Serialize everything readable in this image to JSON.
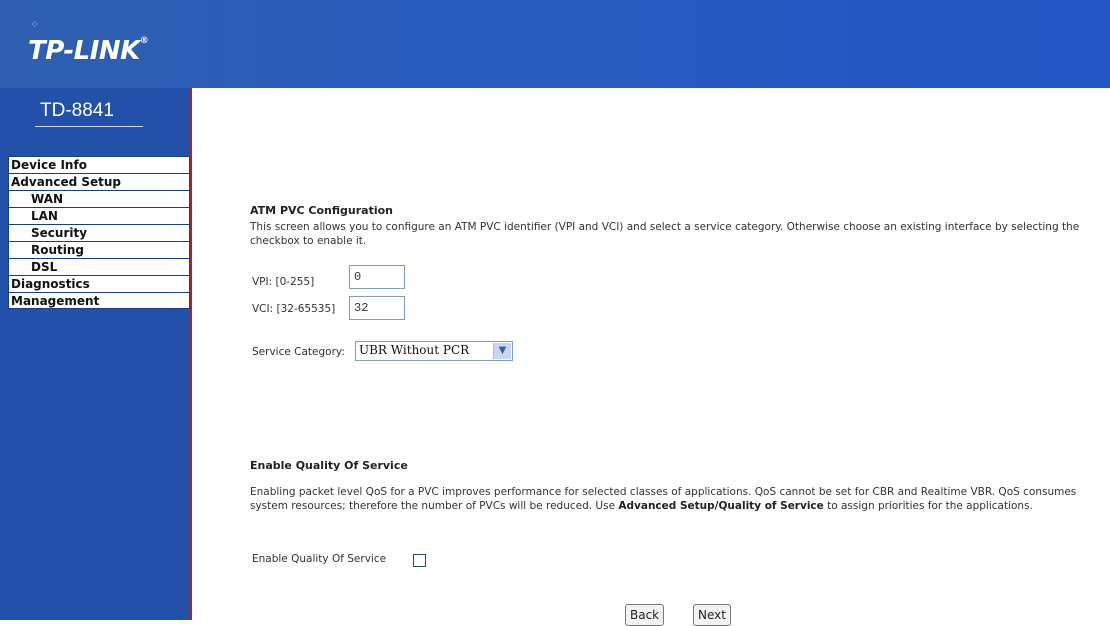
{
  "brand": {
    "logo_text": "TP-LINK",
    "logo_mark": "®",
    "model": "TD-8841"
  },
  "sidebar": {
    "items": [
      {
        "label": "Device Info",
        "sub": false
      },
      {
        "label": "Advanced Setup",
        "sub": false
      },
      {
        "label": "WAN",
        "sub": true
      },
      {
        "label": "LAN",
        "sub": true
      },
      {
        "label": "Security",
        "sub": true
      },
      {
        "label": "Routing",
        "sub": true
      },
      {
        "label": "DSL",
        "sub": true
      },
      {
        "label": "Diagnostics",
        "sub": false
      },
      {
        "label": "Management",
        "sub": false
      }
    ]
  },
  "atm": {
    "title": "ATM PVC Configuration",
    "description": "This screen allows you to configure an ATM PVC identifier (VPI and VCI) and select a service category. Otherwise choose an existing interface by selecting the checkbox to enable it.",
    "vpi_label": "VPI: [0-255]",
    "vpi_value": "0",
    "vci_label": "VCI: [32-65535]",
    "vci_value": "32",
    "service_label": "Service Category:",
    "service_value": "UBR Without PCR"
  },
  "qos": {
    "title": "Enable Quality Of Service",
    "desc_part1": "Enabling packet level QoS for a PVC improves performance for selected classes of applications.  QoS cannot be set for CBR and Realtime VBR.  QoS consumes system resources; therefore the number of PVCs will be reduced. Use ",
    "desc_bold1": "Advanced Setup",
    "desc_slash": "/",
    "desc_bold2": "Quality of Service",
    "desc_part2": " to assign priorities for the applications.",
    "checkbox_label": "Enable Quality Of Service",
    "checked": false
  },
  "buttons": {
    "back": "Back",
    "next": "Next"
  },
  "colors": {
    "banner": "#2a5bbf",
    "sidebar": "#2350a8",
    "sidebar_border": "#9a2a35"
  }
}
